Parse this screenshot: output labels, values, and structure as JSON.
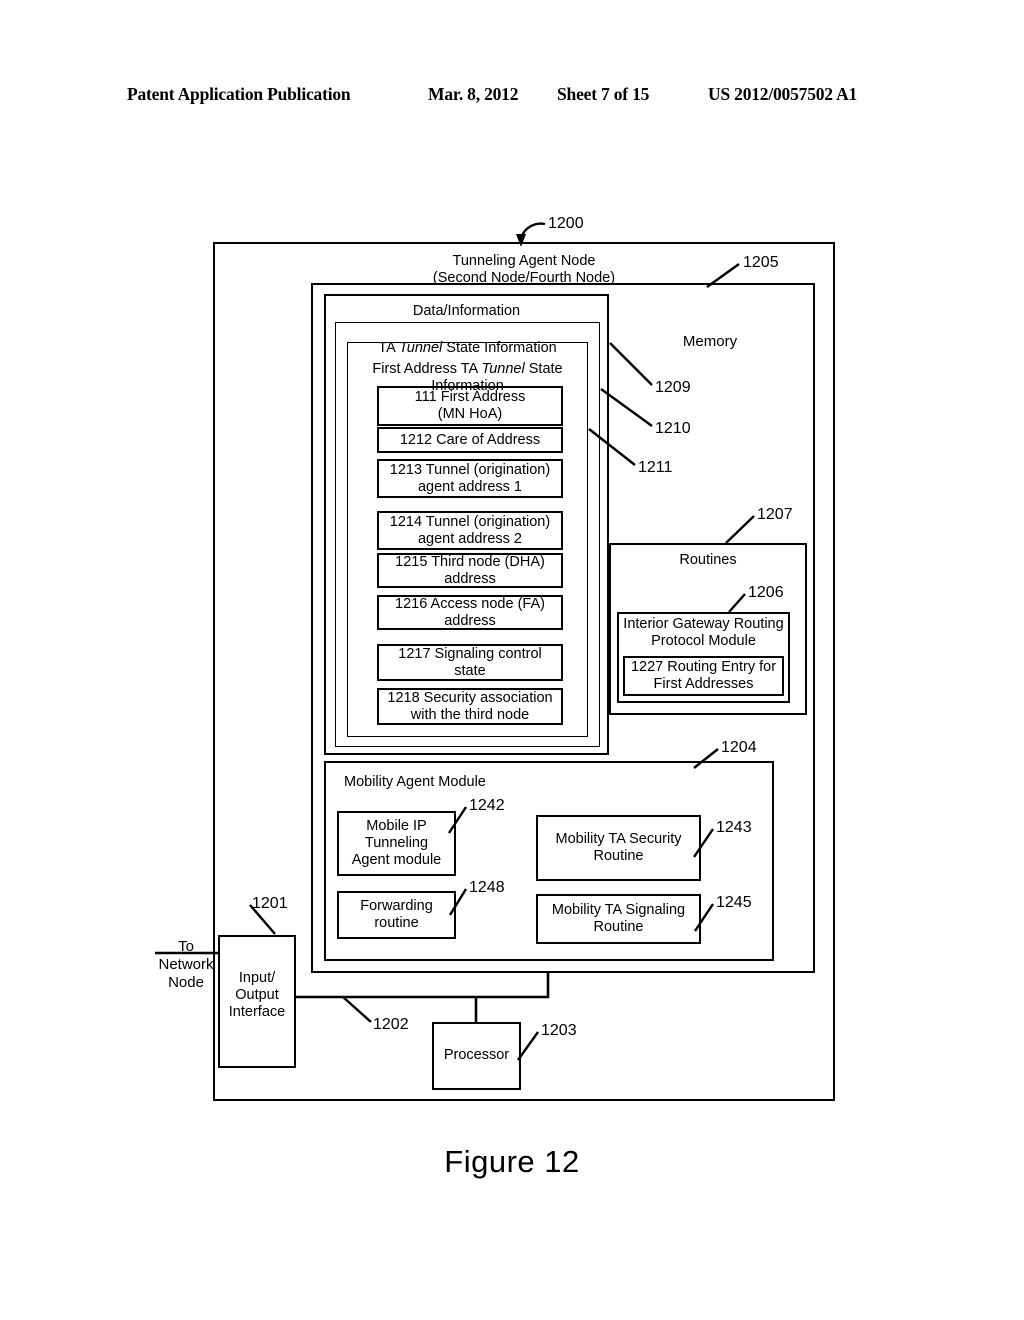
{
  "header": {
    "publication": "Patent Application Publication",
    "date": "Mar. 8, 2012",
    "sheet": "Sheet 7 of 15",
    "number": "US 2012/0057502 A1"
  },
  "figure": {
    "caption": "Figure 12",
    "node_ref": "1200"
  },
  "node": {
    "title": "Tunneling Agent Node\n(Second Node/Fourth Node)",
    "ref": "1205"
  },
  "memory": {
    "label": "Memory",
    "ref": "1207"
  },
  "data_information": {
    "title": "Data/Information",
    "ref": "1209"
  },
  "ta_tunnel_state": {
    "title_pre": "TA ",
    "title_italic": "Tunnel",
    "title_post": " State Information",
    "ref": "1210"
  },
  "first_address_state": {
    "title_pre": "First Address TA ",
    "title_italic": "Tunnel",
    "title_post": " State\nInformation",
    "ref": "1211"
  },
  "state_entries": [
    {
      "label": "111 First Address\n(MN HoA)"
    },
    {
      "label": "1212 Care of Address"
    },
    {
      "label": "1213 Tunnel (origination)\nagent address 1"
    },
    {
      "label": "1214 Tunnel (origination)\nagent address 2"
    },
    {
      "label": "1215 Third node (DHA)\naddress"
    },
    {
      "label": "1216 Access node (FA)\naddress"
    },
    {
      "label": "1217 Signaling control\nstate"
    },
    {
      "label": "1218 Security association\nwith the third node"
    }
  ],
  "routines": {
    "title": "Routines",
    "ref": "1206",
    "igp_module": {
      "label": "Interior Gateway Routing\nProtocol Module"
    },
    "routing_entry": {
      "label": "1227 Routing Entry for\nFirst Addresses"
    }
  },
  "mobility_agent_module": {
    "title": "Mobility Agent Module",
    "ref": "1204",
    "items": [
      {
        "label": "Mobile IP\nTunneling\nAgent module",
        "ref": "1242"
      },
      {
        "label": "Mobility TA Security\nRoutine",
        "ref": "1243"
      },
      {
        "label": "Forwarding\nroutine",
        "ref": "1248"
      },
      {
        "label": "Mobility TA Signaling\nRoutine",
        "ref": "1245"
      }
    ]
  },
  "io_interface": {
    "label": "Input/\nOutput\nInterface",
    "ref": "1201",
    "external_label": "To\nNetwork\nNode"
  },
  "bus": {
    "ref": "1202"
  },
  "processor": {
    "label": "Processor",
    "ref": "1203"
  }
}
